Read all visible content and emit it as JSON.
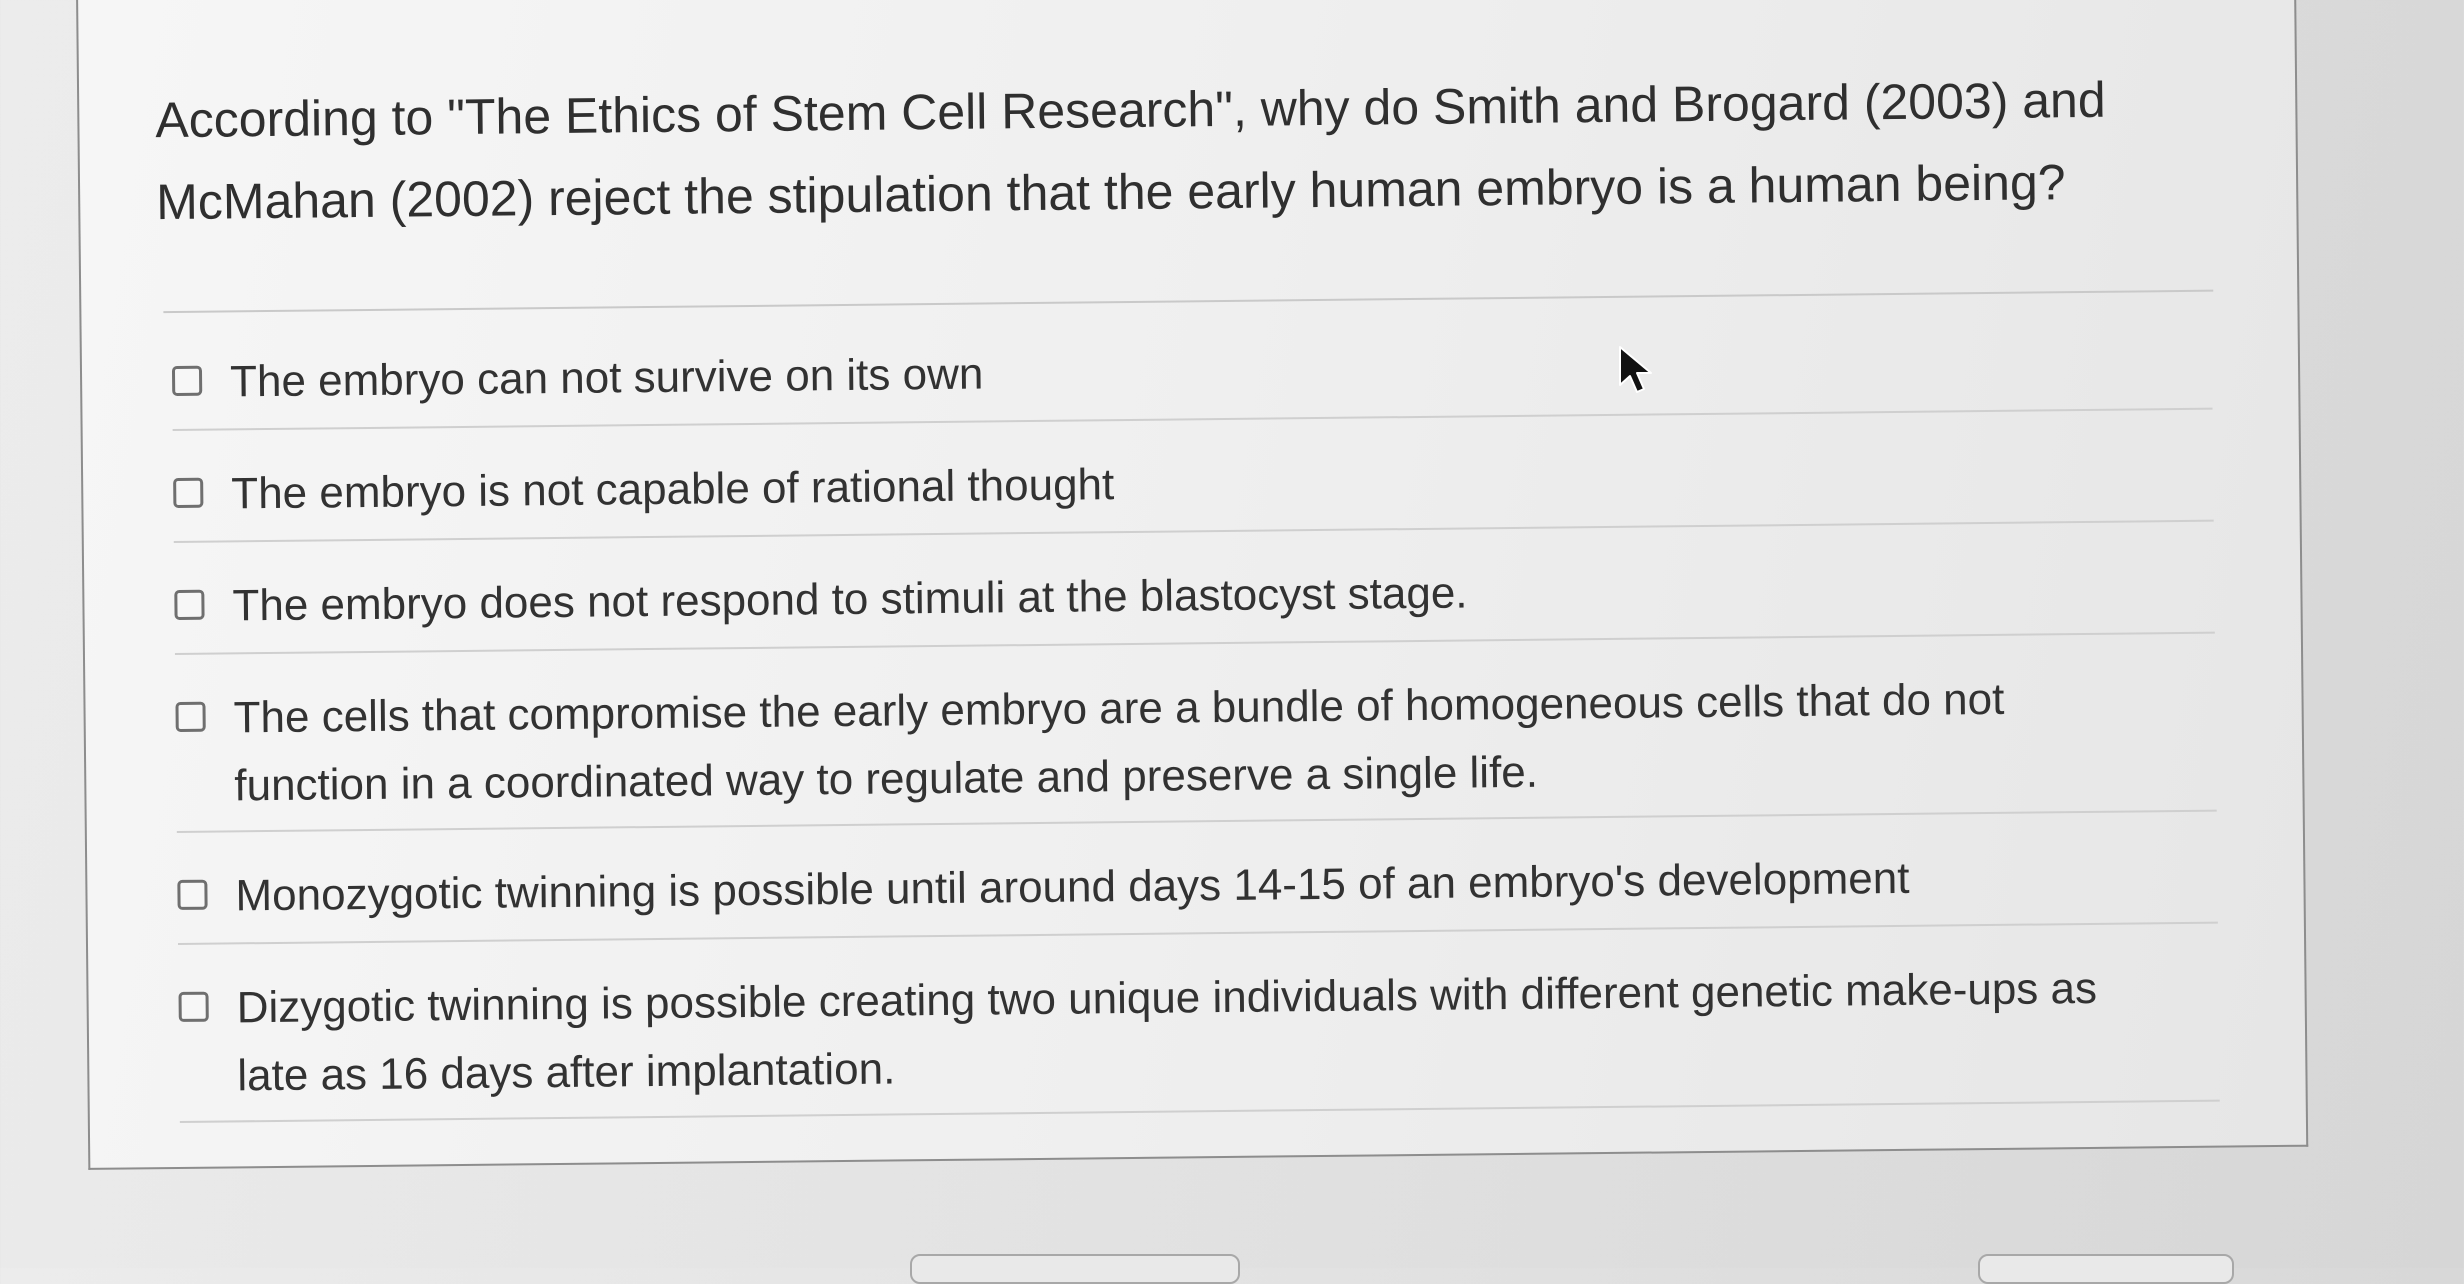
{
  "question": {
    "text": "According to \"The Ethics of Stem Cell Research\", why do Smith and Brogard (2003) and McMahan (2002) reject the stipulation that the early human embryo is a human being?"
  },
  "options": [
    {
      "label": "The embryo can not survive on its own",
      "checked": false
    },
    {
      "label": "The embryo is not capable of rational thought",
      "checked": false
    },
    {
      "label": "The embryo does not respond to stimuli at the blastocyst stage.",
      "checked": false
    },
    {
      "label": "The cells that compromise the early embryo are a bundle of homogeneous cells that do not function in a coordinated way to regulate and preserve a single life.",
      "checked": false
    },
    {
      "label": "Monozygotic twinning is possible until around days 14-15 of an embryo's development",
      "checked": false
    },
    {
      "label": "Dizygotic twinning is possible creating two unique individuals with different genetic make-ups as late as 16 days after implantation.",
      "checked": false
    }
  ],
  "icons": {
    "checkbox": "checkbox-empty-icon",
    "cursor": "mouse-pointer-icon"
  },
  "colors": {
    "page_background": "#e4e4e4",
    "card_background": "#f2f2f2",
    "card_border": "#8d8d8d",
    "divider": "#cfcfcf",
    "text": "#323232"
  }
}
